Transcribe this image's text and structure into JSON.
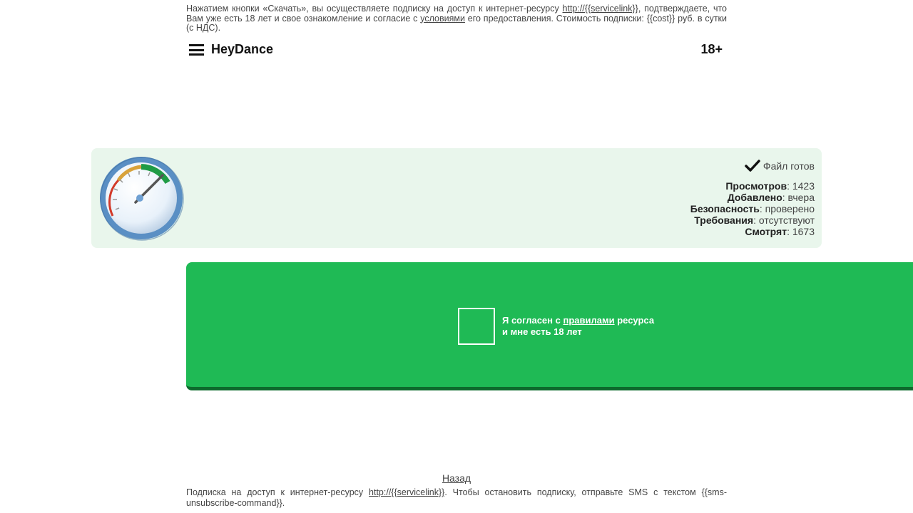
{
  "top_disclaimer": {
    "part1": "Нажатием кнопки «Скачать», вы осуществляете подписку на доступ к интернет-ресурсу ",
    "service_link": "http://{{servicelink}}",
    "part2": ", подтверждаете, что Вам уже есть 18 лет и свое ознакомление и согласие с ",
    "terms_link": "условиями",
    "part3": " его предоставления. Стоимость подписки: {{cost}} руб. в сутки (с НДС)."
  },
  "header": {
    "menu_icon": "hamburger-icon",
    "brand": "HeyDance",
    "age_badge": "18+"
  },
  "info_panel": {
    "gauge_icon": "speedometer-icon",
    "file_ready": "Файл готов",
    "stats": [
      {
        "label": "Просмотров",
        "value": ": 1423"
      },
      {
        "label": "Добавлено",
        "value": ": вчера"
      },
      {
        "label": "Безопасность",
        "value": ": проверено"
      },
      {
        "label": "Требования",
        "value": ": отсутствуют"
      },
      {
        "label": "Смотрят",
        "value": ": 1673"
      }
    ]
  },
  "agree": {
    "text_before": "Я согласен с ",
    "rules_link": "правилами",
    "text_after": " ресурса",
    "line2": "и мне есть 18 лет",
    "checked": false
  },
  "back_link": "Назад",
  "bottom_disclaimer": {
    "part1": "Подписка на доступ к интернет-ресурсу ",
    "service_link": "http://{{servicelink}}",
    "part2": ". Чтобы остановить подписку, отправьте SMS с текстом {{sms-unsubscribe-command}}."
  },
  "colors": {
    "panel_bg": "#e9f6ec",
    "agree_green": "#1fba55",
    "agree_shadow": "#0d6a2c"
  }
}
